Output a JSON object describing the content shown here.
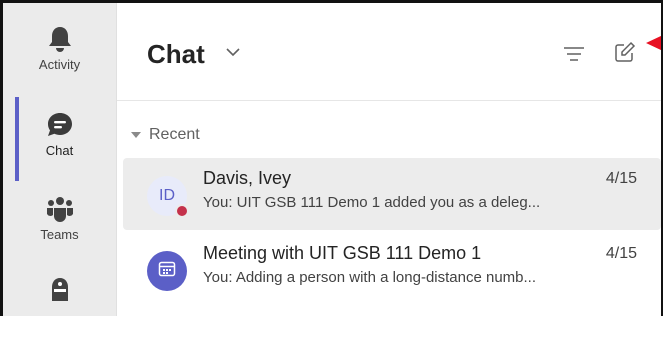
{
  "rail": {
    "items": [
      {
        "label": "Activity",
        "icon": "bell-icon"
      },
      {
        "label": "Chat",
        "icon": "chat-icon",
        "active": true
      },
      {
        "label": "Teams",
        "icon": "teams-icon"
      },
      {
        "label": "",
        "icon": "assignments-icon"
      }
    ]
  },
  "header": {
    "title": "Chat"
  },
  "section": {
    "label": "Recent"
  },
  "chats": [
    {
      "initials": "ID",
      "name": "Davis, Ivey",
      "date": "4/15",
      "preview": "You: UIT GSB 111 Demo 1 added you as a deleg..."
    },
    {
      "name": "Meeting with UIT GSB 111 Demo 1",
      "date": "4/15",
      "preview": "You: Adding a person with a long-distance numb..."
    }
  ],
  "colors": {
    "accent": "#5b5fc7",
    "presence_busy": "#c4314b",
    "annotation_arrow": "#e81123"
  }
}
